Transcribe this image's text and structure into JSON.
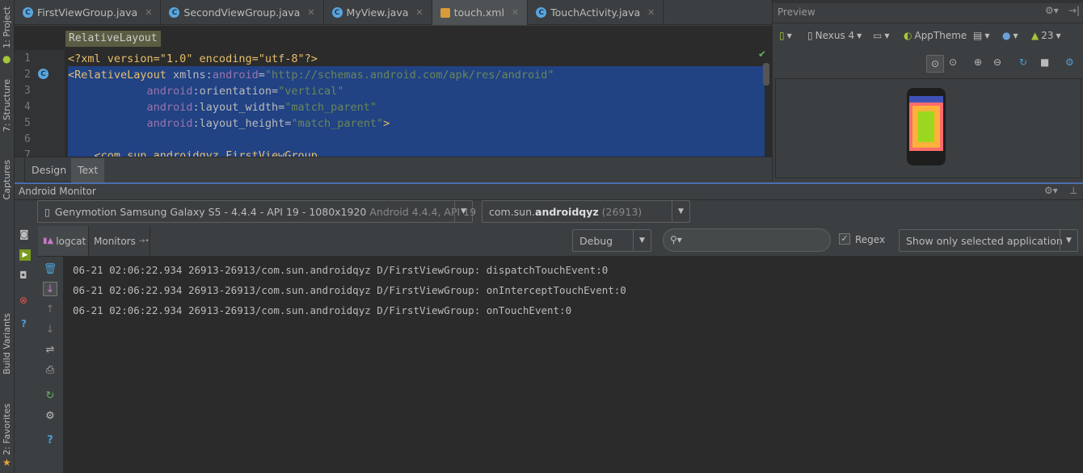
{
  "left_stripe": {
    "items": [
      "1: Project",
      "7: Structure",
      "Captures",
      "Build Variants",
      "2: Favorites"
    ]
  },
  "editor_tabs": [
    {
      "label": "FirstViewGroup.java",
      "icon": "class-icon",
      "active": false
    },
    {
      "label": "SecondViewGroup.java",
      "icon": "class-icon",
      "active": false
    },
    {
      "label": "MyView.java",
      "icon": "class-icon",
      "active": false
    },
    {
      "label": "touch.xml",
      "icon": "xml-file-icon",
      "active": true
    },
    {
      "label": "TouchActivity.java",
      "icon": "class-icon",
      "active": false
    }
  ],
  "editor": {
    "breadcrumb": "RelativeLayout",
    "line_numbers": [
      "1",
      "2",
      "3",
      "4",
      "5",
      "6",
      "7"
    ],
    "lines": {
      "l1": "<?xml version=\"1.0\" encoding=\"utf-8\"?>",
      "l2a": "<RelativeLayout ",
      "l2b": "xmlns:",
      "l2c": "android",
      "l2d": "=",
      "l2e": "\"http://schemas.android.com/apk/res/android\"",
      "indent": "            ",
      "ns": "android",
      "l3a": ":orientation=",
      "l3b": "\"vertical\"",
      "l4a": ":layout_width=",
      "l4b": "\"match_parent\"",
      "l5a": ":layout_height=",
      "l5b": "\"match_parent\"",
      "l5c": ">",
      "l7": "    <com.sun.androidqyz.FirstViewGroup"
    },
    "bottom_tabs": [
      "Design",
      "Text"
    ],
    "active_bottom_tab": "Text"
  },
  "preview": {
    "title": "Preview",
    "device": "Nexus 4",
    "theme": "AppTheme",
    "api": "23"
  },
  "monitor": {
    "title": "Android Monitor",
    "device_select": {
      "main": "Genymotion Samsung Galaxy S5 - 4.4.4 - API 19 - 1080x1920",
      "secondary": "Android 4.4.4, API 19"
    },
    "process_select": {
      "prefix": "com.sun.",
      "bold": "androidqyz",
      "pid": "(26913)"
    },
    "tabs": [
      "logcat",
      "Monitors"
    ],
    "level": "Debug",
    "search": "",
    "regex_label": "Regex",
    "regex_checked": true,
    "filter": "Show only selected application",
    "log_lines": [
      "06-21 02:06:22.934 26913-26913/com.sun.androidqyz D/FirstViewGroup: dispatchTouchEvent:0",
      "06-21 02:06:22.934 26913-26913/com.sun.androidqyz D/FirstViewGroup: onInterceptTouchEvent:0",
      "06-21 02:06:22.934 26913-26913/com.sun.androidqyz D/FirstViewGroup: onTouchEvent:0"
    ]
  },
  "colors": {
    "selection": "#214283",
    "editor_bg": "#2b2b2b",
    "panel_bg": "#3c3f41",
    "string": "#6a8759",
    "tag": "#e8bf6a",
    "namespace": "#9876aa"
  }
}
